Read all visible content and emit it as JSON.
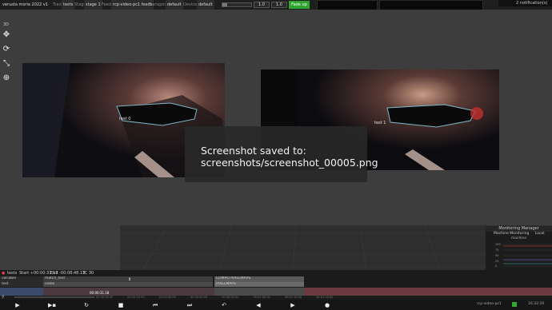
{
  "topbar": {
    "project": "verusta moria 2022 v1",
    "track_label": "Track",
    "track_value": "tests",
    "stage_label": "Stage",
    "stage_value": "stage 1",
    "feed_label": "Feed",
    "feed_value": "rcp-video-pc1 feeds",
    "transport_label": "Transport",
    "transport_value": "default",
    "devices_label": "Devices",
    "devices_value": "default",
    "slider1_value": "1.0",
    "slider2_value": "1.0",
    "fade_label": "Fade up",
    "notifications": "2 notification(s)"
  },
  "toolbar": {
    "label_3d": "3D",
    "tools": [
      {
        "name": "move-tool",
        "icon": "move-arrows-icon",
        "glyph": "✥"
      },
      {
        "name": "rotate-tool",
        "icon": "rotate-icon",
        "glyph": "⟳"
      },
      {
        "name": "scale-tool",
        "icon": "scale-icon",
        "glyph": "⤡"
      },
      {
        "name": "globe-tool",
        "icon": "globe-icon",
        "glyph": "⊕"
      }
    ]
  },
  "stage": {
    "video_left_label": "test 0",
    "video_right_label": "test 1",
    "toast_line1": "Screenshot saved to:",
    "toast_line2": "screenshots/screenshot_00005.png"
  },
  "monitoring": {
    "title": "Monitoring Manager",
    "tab_active": "Machine Monitoring",
    "tab_other": "Local",
    "column": "machine",
    "y_labels": [
      "100",
      "75",
      "50",
      "25",
      "0"
    ]
  },
  "timeline": {
    "tab": "tests",
    "start": "Start +00:00:31.17",
    "end": "End -00:08:48.13",
    "tc": "TC 30",
    "tracks": [
      {
        "label": "variable",
        "value": "match_test"
      },
      {
        "label": "test",
        "value": "video"
      }
    ],
    "clip_header": "COMPO PIXELMAPS",
    "clip_item": "PIXELMAPS",
    "time_cursor": "00:00:31.18",
    "ticks": [
      "00:00:10.00",
      "00:00:20.00",
      "00:00:30.00",
      "00:00:40.00",
      "00:00:50.00",
      "00:01:00.00",
      "00:01:10.00",
      "00:01:20.00",
      "00:01:30.00",
      "00:01:40.00",
      "00:01:50.00",
      "00:02:00.00"
    ]
  },
  "transport": {
    "machine": "rcp-video-pc1",
    "clock": "16:32:20"
  }
}
